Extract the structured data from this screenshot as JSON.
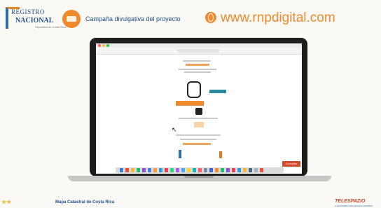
{
  "header": {
    "logo_line1": "REGISTRO",
    "logo_line2": "NACIONAL",
    "logo_line3": "República de Costa Rica",
    "campaign": "Campaña divulgativa del proyecto",
    "url": "www.rnpdigital.com"
  },
  "laptop": {
    "corner_button": "Consultar"
  },
  "footer": {
    "left_text": "Mapa Catastral de Costa Rica",
    "right_logo": "TELESPAZIO",
    "right_sub": "A LEONARDO AND THALES COMPANY"
  },
  "colors": {
    "brand_blue": "#1f4f88",
    "brand_orange": "#f08a2c"
  }
}
